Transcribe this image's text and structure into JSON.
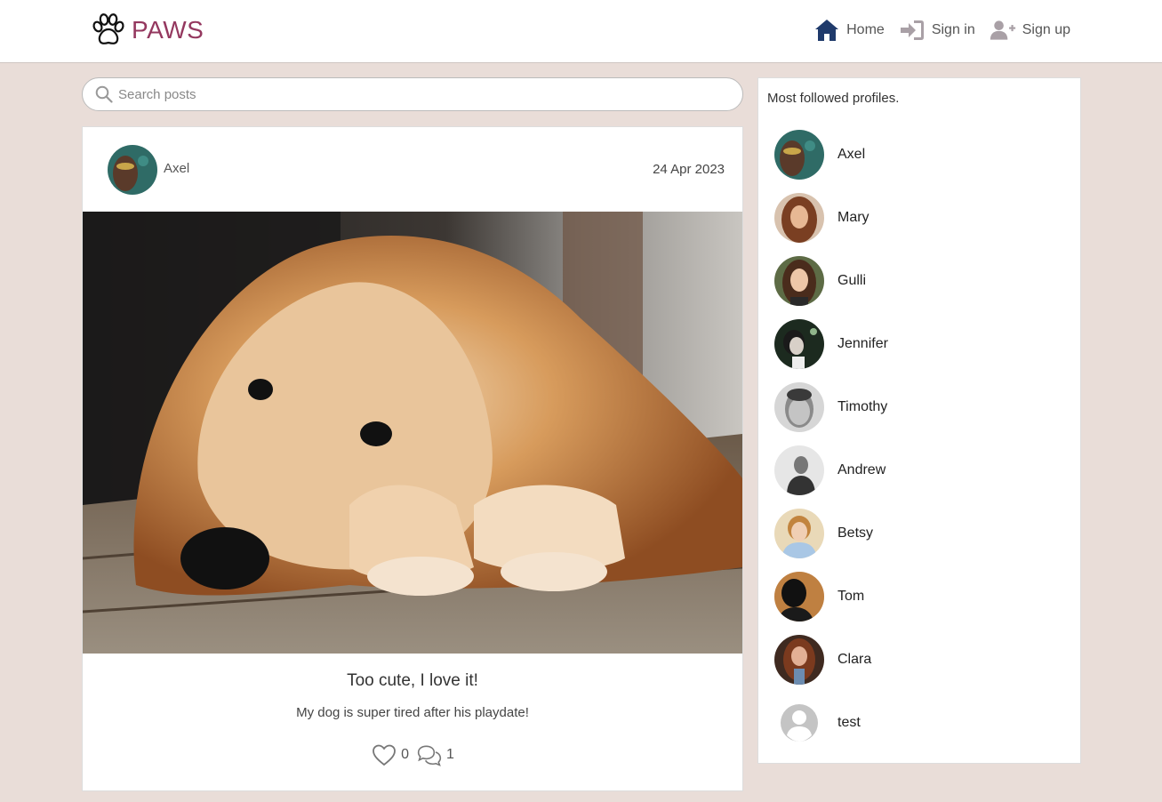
{
  "brand": {
    "name": "PAWS",
    "color": "#94385f"
  },
  "nav": {
    "home": "Home",
    "sign_in": "Sign in",
    "sign_up": "Sign up"
  },
  "search": {
    "placeholder": "Search posts"
  },
  "post": {
    "author": "Axel",
    "date": "24 Apr 2023",
    "title": "Too cute, I love it!",
    "text": "My dog is super tired after his playdate!",
    "likes": "0",
    "comments": "1"
  },
  "sidebar": {
    "title": "Most followed profiles.",
    "profiles": [
      {
        "name": "Axel"
      },
      {
        "name": "Mary"
      },
      {
        "name": "Gulli"
      },
      {
        "name": "Jennifer"
      },
      {
        "name": "Timothy"
      },
      {
        "name": "Andrew"
      },
      {
        "name": "Betsy"
      },
      {
        "name": "Tom"
      },
      {
        "name": "Clara"
      },
      {
        "name": "test"
      }
    ]
  },
  "colors": {
    "background": "#e9ddd8",
    "home_icon": "#1f3a6b",
    "muted_icon": "#a9a0a6"
  }
}
